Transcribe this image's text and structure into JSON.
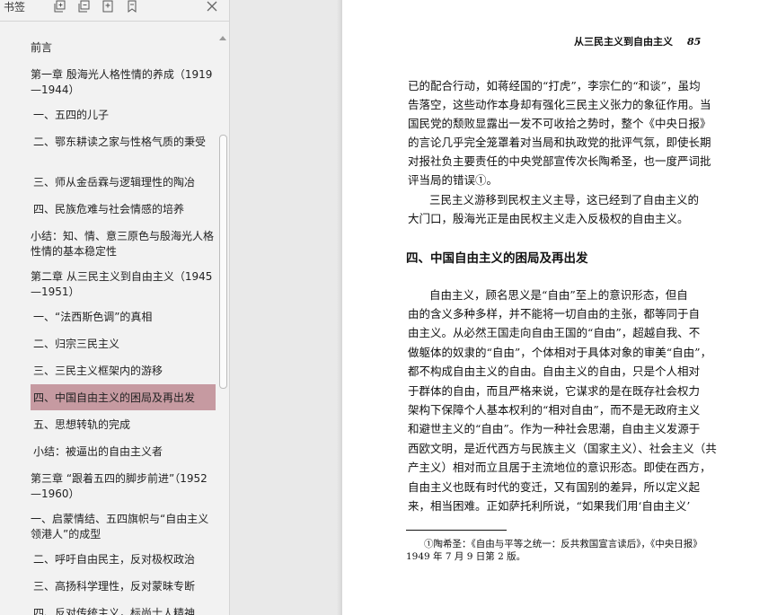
{
  "sidebar": {
    "title": "书签",
    "toolbar": {
      "icons": [
        "expand-all-icon",
        "collapse-all-icon",
        "add-bookmark-icon",
        "bookmark-options-icon",
        "close-icon"
      ]
    },
    "items": [
      {
        "label": "前言"
      },
      {
        "label": "第一章  殷海光人格性情的养成（1919—1944）"
      },
      {
        "label": "一、五四的儿子"
      },
      {
        "label": "二、鄂东耕读之家与性格气质的秉受"
      },
      {
        "label": "三、师从金岳霖与逻辑理性的陶冶"
      },
      {
        "label": "四、民族危难与社会情感的培养"
      },
      {
        "label": "小结：知、情、意三原色与殷海光人格性情的基本稳定性"
      },
      {
        "label": "第二章  从三民主义到自由主义（1945—1951）"
      },
      {
        "label": "一、“法西斯色调”的真相"
      },
      {
        "label": "二、归宗三民主义"
      },
      {
        "label": "三、三民主义框架内的游移"
      },
      {
        "label": "四、中国自由主义的困局及再出发"
      },
      {
        "label": "五、思想转轨的完成"
      },
      {
        "label": "小结：被逼出的自由主义者"
      },
      {
        "label": "第三章  “跟着五四的脚步前进”（1952—1960）"
      },
      {
        "label": "一、启蒙情结、五四旗帜与“自由主义领港人”的成型"
      },
      {
        "label": "二、呼吁自由民主，反对极权政治"
      },
      {
        "label": "三、高扬科学理性，反对蒙昧专断"
      },
      {
        "label": "四、反对传统主义，标尚士人精神"
      }
    ],
    "selected_index": 11,
    "highlight_color": "#c69aa1"
  },
  "document": {
    "running_head": "从三民主义到自由主义",
    "page_number": "85",
    "lines_before": [
      {
        "text": "已的配合行动，如蒋经国的“打虎”，李宗仁的“和谈”，虽均",
        "indent": false
      },
      {
        "text": "告落空，这些动作本身却有强化三民主义张力的象征作用。当",
        "indent": false
      },
      {
        "text": "国民党的颓败显露出一发不可收拾之势时，整个《中央日报》",
        "indent": false
      },
      {
        "text": "的言论几乎完全笼罩着对当局和执政党的批评气氛，即使长期",
        "indent": false
      },
      {
        "text": "对报社负主要责任的中央党部宣传次长陶希圣，也一度严词批",
        "indent": false
      },
      {
        "text": "评当局的错误①。",
        "indent": false
      },
      {
        "text": "三民主义游移到民权主义主导，这已经到了自由主义的",
        "indent": true
      },
      {
        "text": "大门口，殷海光正是由民权主义走入反极权的自由主义。",
        "indent": false
      }
    ],
    "section_heading": "四、中国自由主义的困局及再出发",
    "lines_after": [
      {
        "text": "自由主义，顾名思义是“自由”至上的意识形态，但自",
        "indent": true
      },
      {
        "text": "由的含义多种多样，并不能将一切自由的主张，都等同于自",
        "indent": false
      },
      {
        "text": "由主义。从必然王国走向自由王国的“自由”，超越自我、不",
        "indent": false
      },
      {
        "text": "做躯体的奴隶的“自由”，个体相对于具体对象的审美“自由”，",
        "indent": false
      },
      {
        "text": "都不构成自由主义的自由。自由主义的自由，只是个人相对",
        "indent": false
      },
      {
        "text": "于群体的自由，而且严格来说，它谋求的是在既存社会权力",
        "indent": false
      },
      {
        "text": "架构下保障个人基本权利的“相对自由”，而不是无政府主义",
        "indent": false
      },
      {
        "text": "和避世主义的“自由”。作为一种社会思潮，自由主义发源于",
        "indent": false
      },
      {
        "text": "西欧文明，是近代西方与民族主义（国家主义）、社会主义（共",
        "indent": false
      },
      {
        "text": "产主义）相对而立且居于主流地位的意识形态。即使在西方，",
        "indent": false
      },
      {
        "text": "自由主义也既有时代的变迁，又有国别的差异，所以定义起",
        "indent": false
      },
      {
        "text": "来，相当困难。正如萨托利所说，“如果我们用‘自由主义’",
        "indent": false
      }
    ],
    "footnote_line1": "①陶希圣：《自由与平等之统一：反共救国宣言读后》，《中央日报》",
    "footnote_line2": "1949 年 7 月 9 日第 2 版。"
  }
}
